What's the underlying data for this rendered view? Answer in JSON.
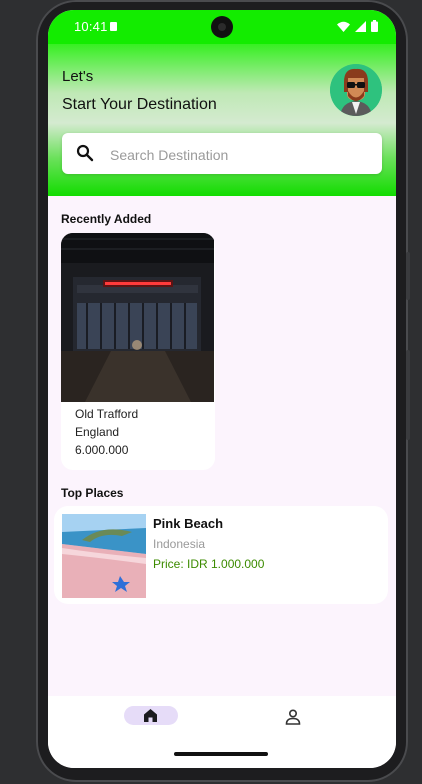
{
  "status_bar": {
    "time": "10:41",
    "background": "#13ec00"
  },
  "header": {
    "greeting": "Let's",
    "title": "Start Your Destination",
    "avatar_icon": "user-avatar"
  },
  "search": {
    "placeholder": "Search Destination",
    "icon": "search-icon"
  },
  "recently_added": {
    "heading": "Recently Added",
    "items": [
      {
        "name": "Old Trafford",
        "country": "England",
        "price": "6.000.000",
        "image": "stadium-night-photo"
      }
    ]
  },
  "top_places": {
    "heading": "Top Places",
    "items": [
      {
        "name": "Pink Beach",
        "country": "Indonesia",
        "price": "Price: IDR 1.000.000",
        "image": "pink-beach-photo"
      }
    ]
  },
  "bottom_nav": {
    "items": [
      {
        "name": "home",
        "icon": "home-icon",
        "active": true
      },
      {
        "name": "profile",
        "icon": "person-icon",
        "active": false
      }
    ],
    "active_pill": "#e6dcf8"
  },
  "colors": {
    "price_green": "#3c8b00",
    "screen_bg": "#fcf4fd",
    "header_green": "#12dc00"
  }
}
